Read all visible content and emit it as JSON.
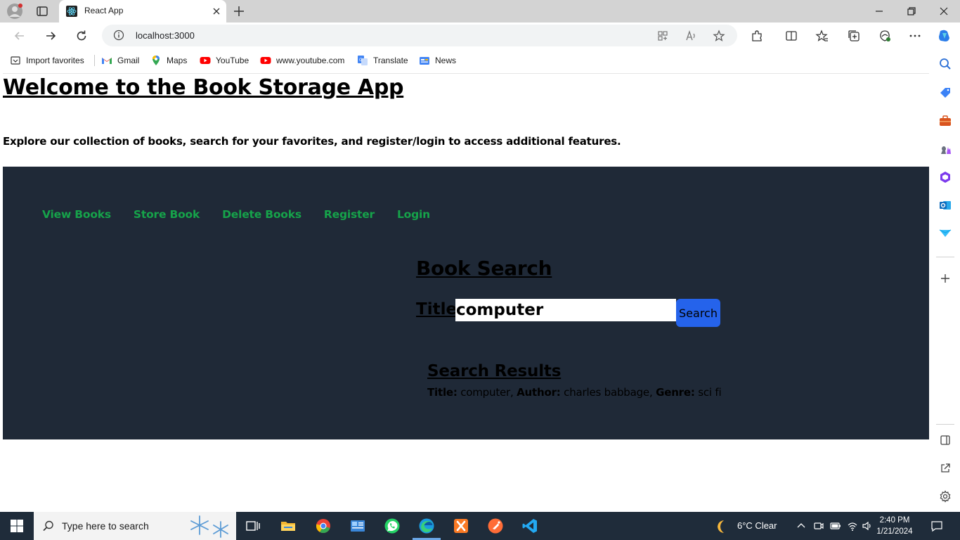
{
  "browser": {
    "tab_title": "React App",
    "url": "localhost:3000",
    "bookmarks": [
      {
        "label": "Import favorites",
        "icon": "import-icon"
      },
      {
        "label": "Gmail",
        "icon": "gmail-icon"
      },
      {
        "label": "Maps",
        "icon": "maps-icon"
      },
      {
        "label": "YouTube",
        "icon": "youtube-icon"
      },
      {
        "label": "www.youtube.com",
        "icon": "youtube-icon"
      },
      {
        "label": "Translate",
        "icon": "translate-icon"
      },
      {
        "label": "News",
        "icon": "news-icon"
      }
    ]
  },
  "page": {
    "title": "Welcome to the Book Storage App",
    "intro": "Explore our collection of books, search for your favorites, and register/login to access additional features.",
    "nav": [
      "View Books",
      "Store Book",
      "Delete Books",
      "Register",
      "Login"
    ],
    "search": {
      "heading": "Book Search",
      "label": "Title:",
      "value": "computer",
      "button": "Search"
    },
    "results": {
      "heading": "Search Results",
      "items": [
        {
          "title_label": "Title:",
          "title": "computer",
          "author_label": "Author:",
          "author": "charles babbage",
          "genre_label": "Genre:",
          "genre": "sci fi"
        }
      ]
    }
  },
  "taskbar": {
    "search_placeholder": "Type here to search",
    "weather": "6°C  Clear",
    "time": "2:40 PM",
    "date": "1/21/2024"
  },
  "colors": {
    "dark_section": "#1f2937",
    "nav_link": "#16a34a",
    "search_button": "#2563eb",
    "taskbar": "#1f2c3a"
  }
}
